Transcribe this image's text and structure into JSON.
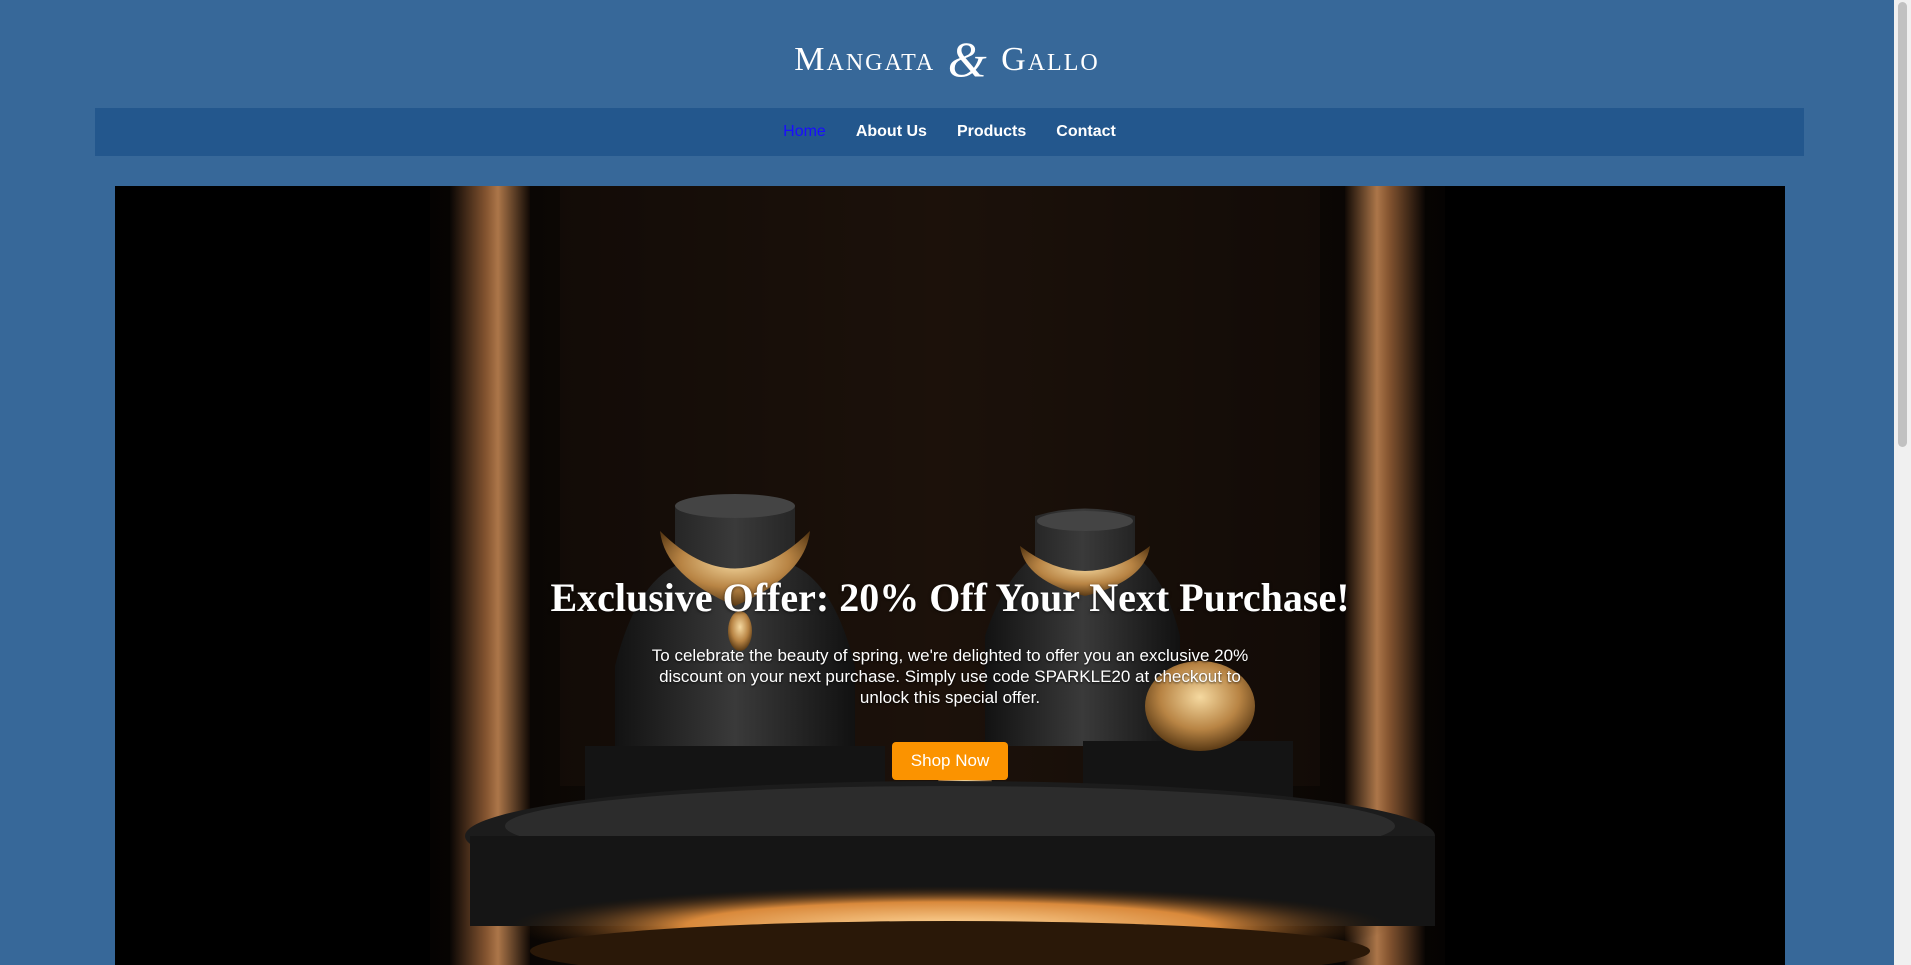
{
  "header": {
    "logo_left": "Mangata",
    "logo_amp": "&",
    "logo_right": "Gallo"
  },
  "nav": {
    "items": [
      {
        "label": "Home",
        "active": true
      },
      {
        "label": "About Us"
      },
      {
        "label": "Products"
      },
      {
        "label": "Contact"
      }
    ]
  },
  "hero": {
    "title": "Exclusive Offer: 20% Off Your Next Purchase!",
    "text": "To celebrate the beauty of spring, we're delighted to offer you an exclusive 20% discount on your next purchase. Simply use code SPARKLE20 at checkout to unlock this special offer.",
    "button_label": "Shop Now",
    "button_color": "#fb9300"
  },
  "colors": {
    "page_bg": "#376899",
    "nav_bg": "#23578d",
    "active_link": "#1a0dff"
  }
}
